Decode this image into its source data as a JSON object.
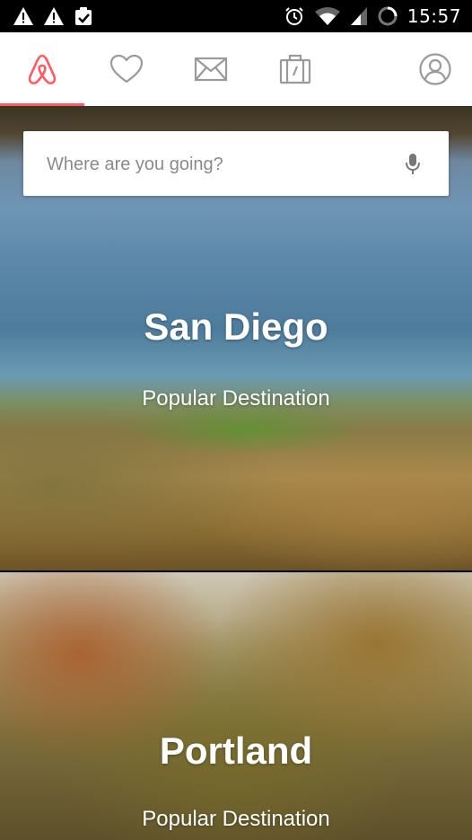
{
  "status_bar": {
    "time": "15:57",
    "left_icons": [
      "warning-icon",
      "warning-icon",
      "clipboard-check-icon"
    ],
    "right_icons": [
      "alarm-icon",
      "wifi-icon",
      "signal-icon",
      "battery-icon"
    ]
  },
  "nav": {
    "active_color": "#ff5a5f",
    "items": [
      {
        "name": "home",
        "icon": "airbnb-logo-icon",
        "active": true
      },
      {
        "name": "wishlists",
        "icon": "heart-icon"
      },
      {
        "name": "inbox",
        "icon": "envelope-icon"
      },
      {
        "name": "trips",
        "icon": "suitcase-icon"
      },
      {
        "name": "profile",
        "icon": "user-icon"
      }
    ]
  },
  "search": {
    "placeholder": "Where are you going?",
    "icon": "microphone-icon"
  },
  "destinations": [
    {
      "title": "San Diego",
      "subtitle": "Popular Destination"
    },
    {
      "title": "Portland",
      "subtitle": "Popular Destination"
    }
  ]
}
